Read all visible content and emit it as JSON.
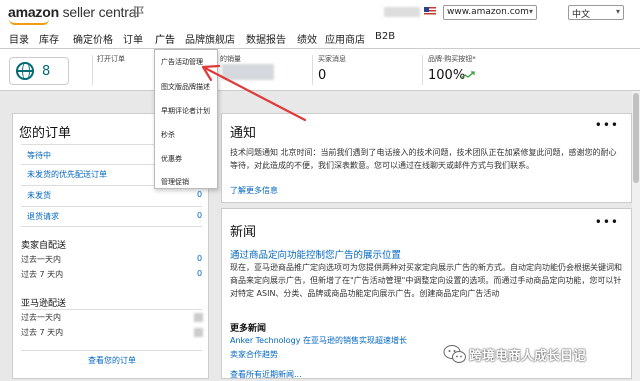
{
  "header": {
    "logo_bold": "amazon",
    "logo_light": " seller central",
    "marketplace": "www.amazon.com",
    "language": "中文"
  },
  "nav": [
    "目录",
    "库存",
    "确定价格",
    "订单",
    "广告",
    "品牌旗舰店",
    "数据报告",
    "绩效",
    "应用商店",
    "B2B"
  ],
  "metrics": {
    "globe_count": "8",
    "open_orders_label": "打开订单",
    "sales_label": "的销量",
    "messages_label": "买家消息",
    "messages_value": "0",
    "feedback_label": "品牌·购买按钮*",
    "feedback_value": "100%"
  },
  "dropdown": [
    "广告活动管理",
    "图文版品牌描述",
    "早期评论者计划",
    "秒杀",
    "优惠券",
    "管理促销"
  ],
  "orders": {
    "title": "您的订单",
    "rows": [
      {
        "label": "等待中",
        "value": ""
      },
      {
        "label": "未发货的优先配送订单",
        "value": ""
      },
      {
        "label": "未发货",
        "value": "0"
      },
      {
        "label": "退货请求",
        "value": "0"
      }
    ],
    "seller_title": "卖家自配送",
    "seller_rows": [
      {
        "label": "过去一天内",
        "value": "0"
      },
      {
        "label": "过去 7 天内",
        "value": "0"
      }
    ],
    "fba_title": "亚马逊配送",
    "fba_rows": [
      {
        "label": "过去一天内"
      },
      {
        "label": "过去 7 天内"
      }
    ],
    "view_link": "查看您的订单"
  },
  "notice": {
    "title": "通知",
    "text": "技术问题通知 北京时间：当前我们遇到了电话接入的技术问题，技术团队正在加紧修复此问题，感谢您的耐心等待，对此造成的不便，我们深表歉意。您可以通过在线聊天或邮件方式与我们联系。",
    "more": "了解更多信息"
  },
  "news": {
    "title": "新闻",
    "headline": "通过商品定向功能控制您广告的展示位置",
    "text": "现在，亚马逊商品推广定向选项可为您提供两种对买家定向展示广告的新方式。自动定向功能仍会根据关键词和商品来定向展示广告，但新增了在\"广告活动管理\"中调整定向设置的选项。而通过手动商品定向功能，您可以针对特定 ASIN、分类、品牌或商品功能定向展示广告。创建商品定向广告活动",
    "more_title": "更多新闻",
    "items": [
      "Anker Technology 在亚马逊的销售实现超速增长",
      "卖家合作趋势"
    ],
    "all_link": "查看所有近期新闻..."
  },
  "watermark": "跨境电商人成长日记",
  "colors": {
    "link": "#0066c0",
    "teal": "#006b75",
    "arrow": "#e03a3a",
    "logo_smile": "#f39c12"
  }
}
